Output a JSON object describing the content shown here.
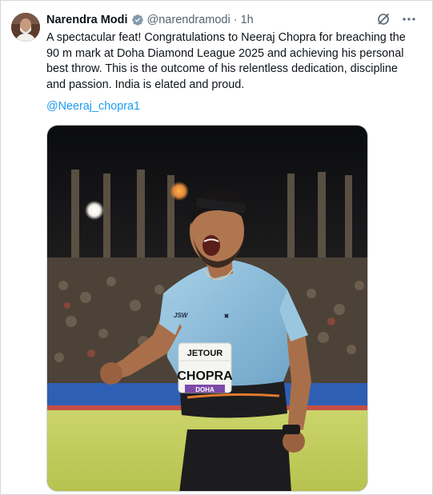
{
  "tweet": {
    "author_name": "Narendra Modi",
    "author_handle": "@narendramodi",
    "separator": "·",
    "time": "1h",
    "text": "A spectacular feat! Congratulations to Neeraj Chopra for breaching the 90 m mark at Doha Diamond League 2025 and achieving his personal best throw. This is the outcome of his relentless dedication, discipline and passion. India is elated and proud.",
    "mention": "@Neeraj_chopra1"
  },
  "icons": {
    "verified": "verified-badge-icon",
    "grok": "grok-icon",
    "more": "more-options-icon"
  },
  "media": {
    "bib_brand": "JETOUR",
    "bib_name": "CHOPRA",
    "bib_event": "DOHA",
    "jersey_logo": "JSW"
  },
  "colors": {
    "link": "#1d9bf0",
    "verified": "#829aab",
    "jersey": "#8fbfdc"
  }
}
